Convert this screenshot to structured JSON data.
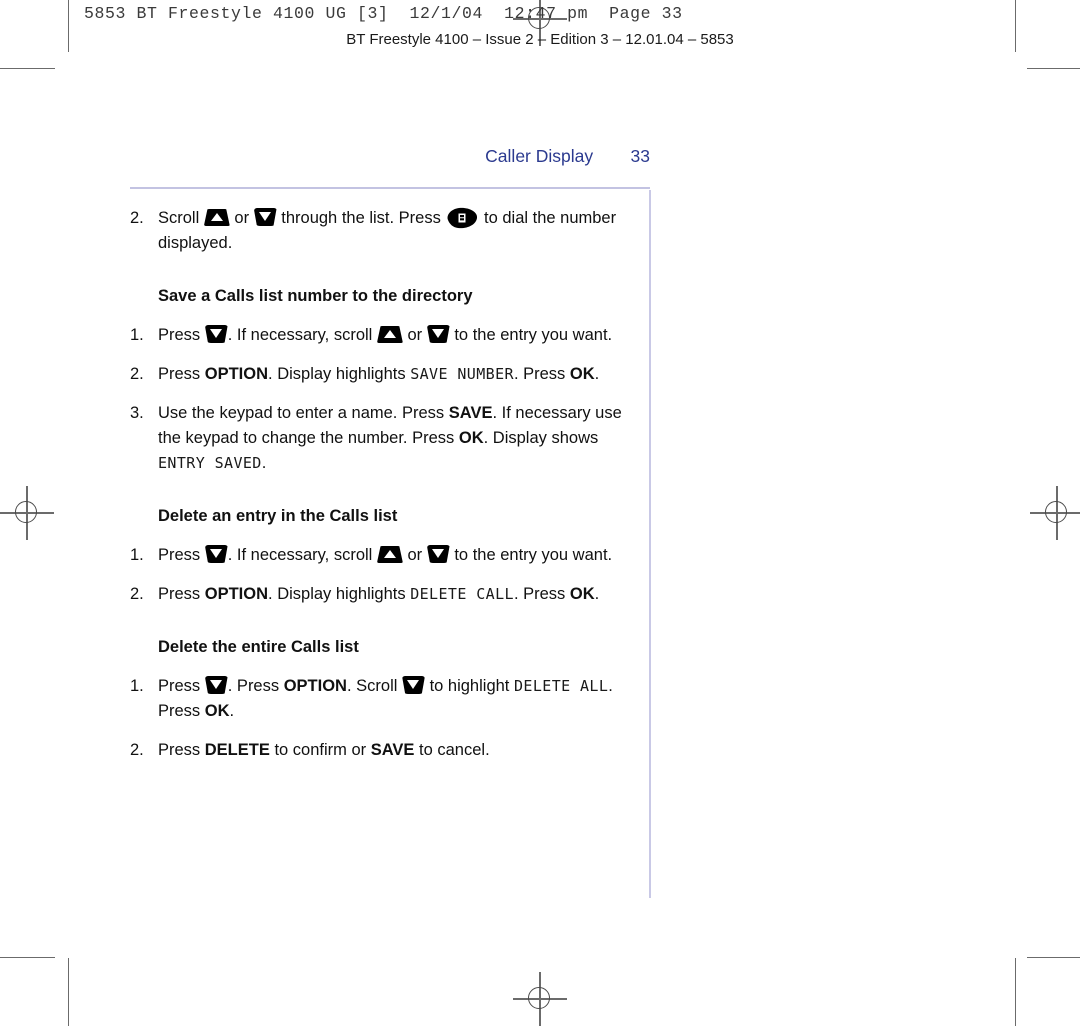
{
  "prepress": {
    "header": "5853 BT Freestyle 4100 UG [3]  12/1/04  12:47 pm  Page 33",
    "edition_line": "BT Freestyle 4100 – Issue 2 – Edition 3 – 12.01.04 – 5853"
  },
  "running_head": {
    "title": "Caller Display",
    "page_number": "33",
    "color": "#2b3a8f",
    "rule_color": "#c3c3e2"
  },
  "icons": {
    "scroll_up": "scroll-up-key-icon",
    "scroll_down": "scroll-down-key-icon",
    "dial": "dial-key-icon"
  },
  "content": {
    "step_intro": {
      "number": "2.",
      "t1": "Scroll ",
      "t2": " or ",
      "t3": " through the list. Press ",
      "t4": " to dial the number displayed."
    },
    "section_save": {
      "heading": "Save a Calls list number to the directory",
      "steps": [
        {
          "number": "1.",
          "t1": "Press ",
          "t2": ". If necessary, scroll ",
          "t3": " or ",
          "t4": " to the entry you want."
        },
        {
          "number": "2.",
          "t1": "Press ",
          "b1": "OPTION",
          "t2": ". Display highlights ",
          "lcd1": "SAVE NUMBER",
          "t3": ". Press ",
          "b2": "OK",
          "t4": "."
        },
        {
          "number": "3.",
          "t1": "Use the keypad to enter a name. Press ",
          "b1": "SAVE",
          "t2": ". If necessary use the keypad to change the number. Press ",
          "b2": "OK",
          "t3": ". Display shows ",
          "lcd1": "ENTRY SAVED",
          "t4": "."
        }
      ]
    },
    "section_delete_entry": {
      "heading": "Delete an entry in the Calls list",
      "steps": [
        {
          "number": "1.",
          "t1": "Press ",
          "t2": ". If necessary, scroll ",
          "t3": " or ",
          "t4": " to the entry you want."
        },
        {
          "number": "2.",
          "t1": "Press ",
          "b1": "OPTION",
          "t2": ". Display highlights ",
          "lcd1": "DELETE CALL",
          "t3": ". Press ",
          "b2": "OK",
          "t4": "."
        }
      ]
    },
    "section_delete_all": {
      "heading": "Delete the entire Calls list",
      "steps": [
        {
          "number": "1.",
          "t1": "Press ",
          "t2": ". Press ",
          "b1": "OPTION",
          "t3": ". Scroll ",
          "t4": " to highlight ",
          "lcd1": "DELETE ALL",
          "t5": ". Press ",
          "b2": "OK",
          "t6": "."
        },
        {
          "number": "2.",
          "t1": "Press ",
          "b1": "DELETE",
          "t2": " to confirm or ",
          "b2": "SAVE",
          "t3": " to cancel."
        }
      ]
    }
  }
}
